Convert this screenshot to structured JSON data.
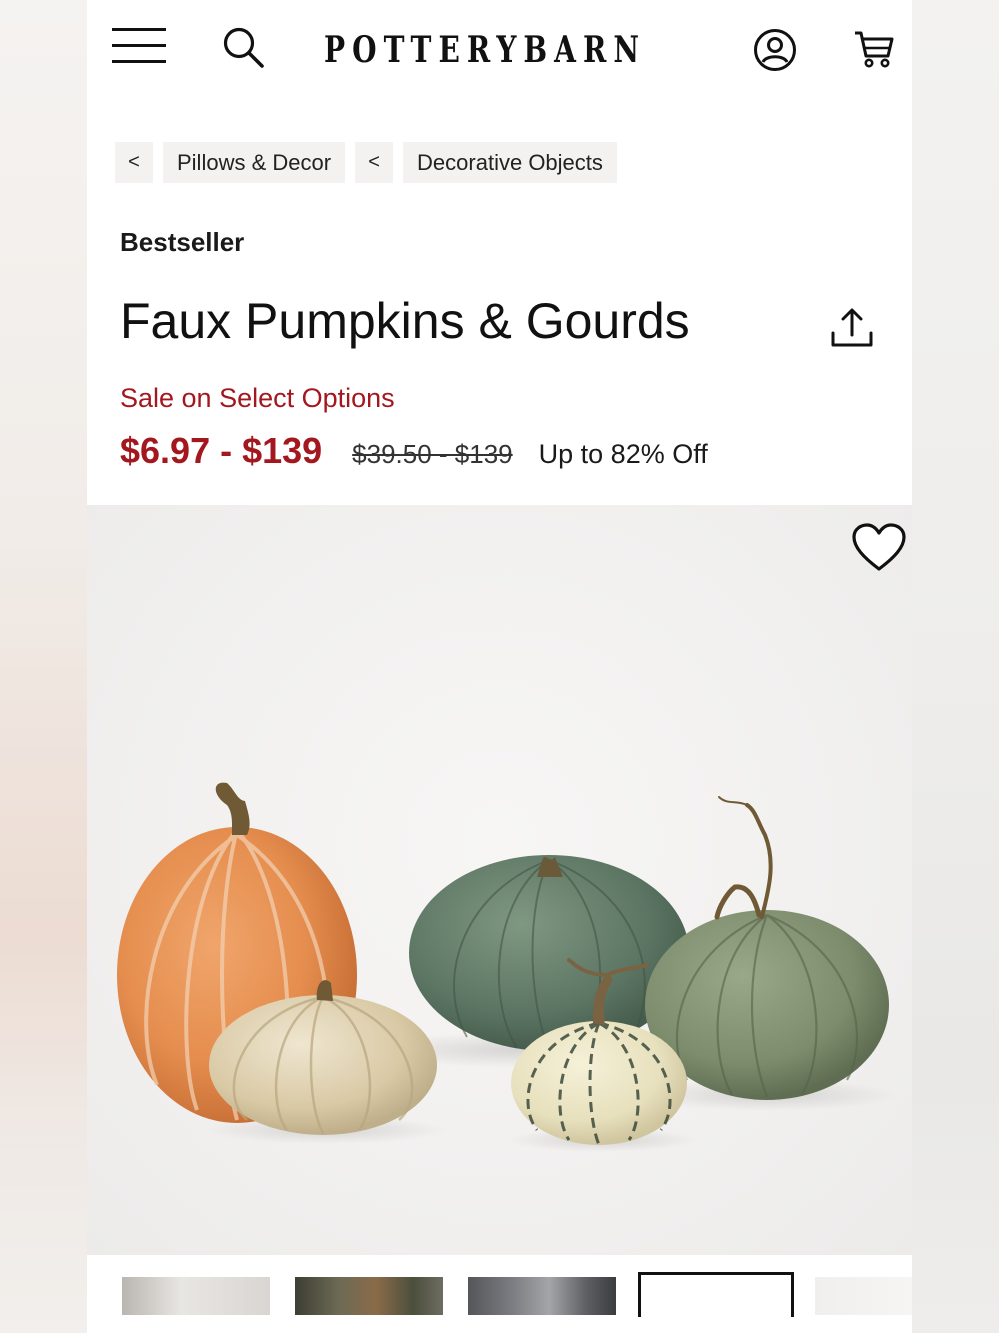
{
  "header": {
    "menu_icon": "hamburger-menu-icon",
    "search_icon": "search-icon",
    "logo_text": "POTTERYBARN",
    "account_icon": "account-icon",
    "cart_icon": "cart-icon"
  },
  "breadcrumb": {
    "back_symbol": "<",
    "items": [
      {
        "label": "Pillows & Decor"
      },
      {
        "label": "Decorative Objects"
      }
    ]
  },
  "product": {
    "badge": "Bestseller",
    "title": "Faux Pumpkins & Gourds",
    "share_icon": "share-icon",
    "sale_label": "Sale on Select Options",
    "sale_price": "$6.97 - $139",
    "original_price": "$39.50 - $139",
    "discount": "Up to 82% Off",
    "favorite_icon": "heart-icon"
  },
  "colors": {
    "sale_red": "#a3171f",
    "text": "#1a1a1a",
    "crumb_bg": "#f4f2f0"
  },
  "gallery": {
    "thumbnail_count": 5,
    "selected_index": 3
  }
}
